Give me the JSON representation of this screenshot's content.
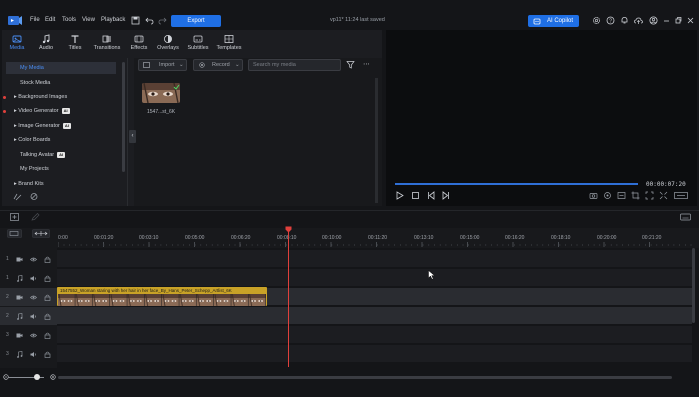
{
  "menu": {
    "file": "File",
    "edit": "Edit",
    "tools": "Tools",
    "view": "View",
    "playback": "Playback"
  },
  "toolbar": {
    "export_label": "Export",
    "project_title": "vp11* 11:24 last saved",
    "ai_copilot_label": "AI Copilot"
  },
  "tabs": [
    {
      "label": "Media",
      "icon": "media-icon"
    },
    {
      "label": "Audio",
      "icon": "music-note-icon"
    },
    {
      "label": "Titles",
      "icon": "titles-icon"
    },
    {
      "label": "Transitions",
      "icon": "transitions-icon"
    },
    {
      "label": "Effects",
      "icon": "effects-icon"
    },
    {
      "label": "Overlays",
      "icon": "overlays-icon"
    },
    {
      "label": "Subtitles",
      "icon": "subtitles-icon"
    },
    {
      "label": "Templates",
      "icon": "templates-icon"
    }
  ],
  "sidebar": {
    "items": [
      {
        "label": "My Media"
      },
      {
        "label": "Stock Media"
      },
      {
        "label": "Background Images"
      },
      {
        "label": "Video Generator",
        "badge": "AI"
      },
      {
        "label": "Image Generator",
        "badge": "AI"
      },
      {
        "label": "Color Boards"
      },
      {
        "label": "Talking Avatar",
        "badge": "AI"
      },
      {
        "label": "My Projects"
      },
      {
        "label": "Brand Kits"
      }
    ]
  },
  "media_toolbar": {
    "import_label": "Import",
    "record_label": "Record",
    "search_placeholder": "Search my media"
  },
  "media_items": [
    {
      "label": "1547...st_6K"
    }
  ],
  "preview": {
    "timecode": "00:00:07:20"
  },
  "timeline": {
    "ticks": [
      "0:00",
      "00:01:20",
      "00:03:10",
      "00:05:00",
      "00:06:20",
      "00:08:10",
      "00:10:00",
      "00:11:20",
      "00:13:10",
      "00:15:00",
      "00:16:20",
      "00:18:10",
      "00:20:00",
      "00:21:20"
    ],
    "tracks": [
      {
        "num": "1",
        "type": "video"
      },
      {
        "num": "1",
        "type": "audio"
      },
      {
        "num": "2",
        "type": "video"
      },
      {
        "num": "2",
        "type": "audio"
      },
      {
        "num": "3",
        "type": "video"
      },
      {
        "num": "3",
        "type": "audio"
      }
    ],
    "clip_title": "1547552_Woman staring with her hair in her face_By_Hans_Peter_Schepp_Artlist_6K"
  },
  "colors": {
    "accent": "#1f6fe5",
    "clip": "#c9a227",
    "playhead": "#e0403c"
  }
}
